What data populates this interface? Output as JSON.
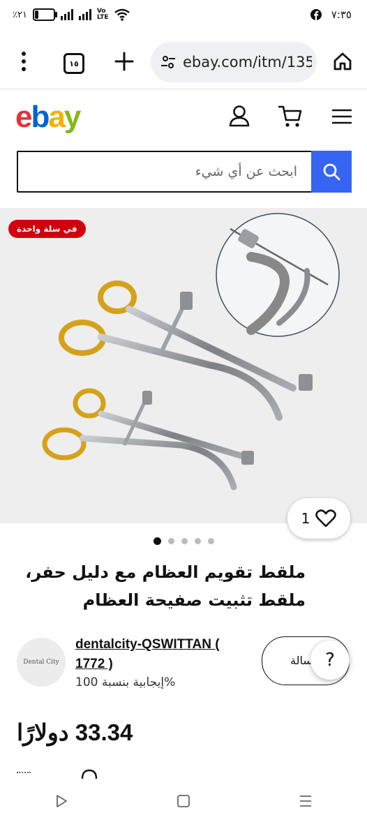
{
  "status_bar": {
    "battery_text": "٪٢١",
    "battery_level": 0.21,
    "network_label": "Vo\nLTE",
    "time": "٧:٣٥"
  },
  "browser": {
    "tab_count": "١٥",
    "url": "ebay.com/itm/135"
  },
  "ebay": {
    "logo_letters": [
      "e",
      "b",
      "a",
      "y"
    ],
    "logo_colors": [
      "#e53238",
      "#0064d2",
      "#f5af02",
      "#86b817"
    ],
    "search_placeholder": "ابحث عن أي شيء",
    "accent": "#3665f3"
  },
  "listing": {
    "badge": "في سلة واحدة",
    "watch_count": "1",
    "image_count": 5,
    "active_image": 1,
    "title": "ملقط تقويم العظام مع دليل حفر، ملقط تثبيت صفيحة العظام",
    "price": "33.34 دولارًا"
  },
  "seller": {
    "avatar_text": "Dental City",
    "name": "dentalcity-QSWITTAN ( 1772 )",
    "feedback": "إيجابية بنسبة 100%",
    "contact_label": "سالة"
  },
  "help_label": "?"
}
